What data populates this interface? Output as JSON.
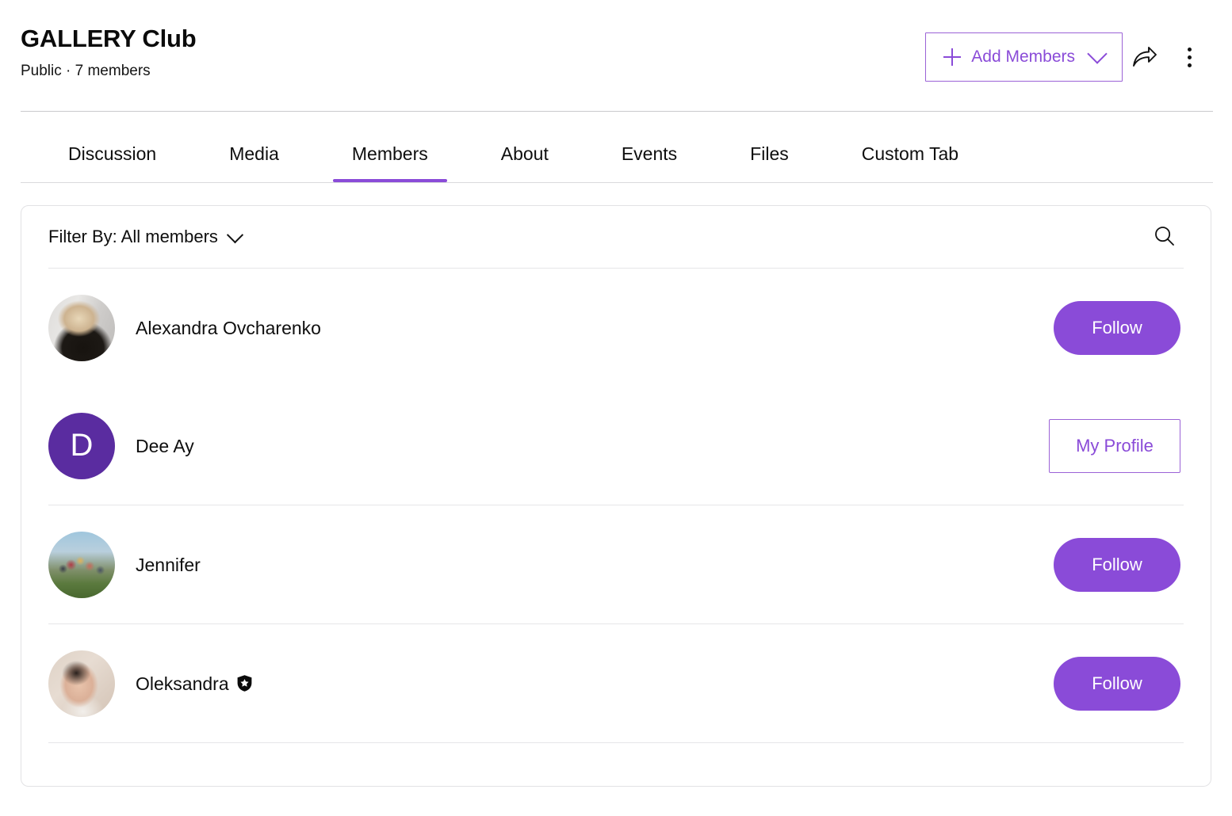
{
  "header": {
    "title": "GALLERY Club",
    "meta": "Public · 7 members",
    "add_members_label": "Add Members",
    "icons": {
      "plus": "plus-icon",
      "chevron": "chevron-down-icon",
      "share": "share-icon",
      "more": "more-vertical-icon"
    }
  },
  "tabs": [
    {
      "label": "Discussion",
      "active": false
    },
    {
      "label": "Media",
      "active": false
    },
    {
      "label": "Members",
      "active": true
    },
    {
      "label": "About",
      "active": false
    },
    {
      "label": "Events",
      "active": false
    },
    {
      "label": "Files",
      "active": false
    },
    {
      "label": "Custom Tab",
      "active": false
    }
  ],
  "filter": {
    "label": "Filter By: All members",
    "chevron_icon": "chevron-down-icon",
    "search_icon": "search-icon"
  },
  "members": [
    {
      "name": "Alexandra Ovcharenko",
      "avatar_type": "photo",
      "avatar_class": "av-alexandra",
      "initial": "",
      "badge": false,
      "action_label": "Follow",
      "action_type": "follow"
    },
    {
      "name": "Dee Ay",
      "avatar_type": "initial",
      "avatar_class": "avatar-initial",
      "initial": "D",
      "badge": false,
      "action_label": "My Profile",
      "action_type": "profile"
    },
    {
      "name": "Jennifer",
      "avatar_type": "photo",
      "avatar_class": "av-jennifer",
      "initial": "",
      "badge": false,
      "action_label": "Follow",
      "action_type": "follow"
    },
    {
      "name": "Oleksandra",
      "avatar_type": "photo",
      "avatar_class": "av-oleksandra",
      "initial": "",
      "badge": true,
      "badge_icon": "shield-star-badge-icon",
      "action_label": "Follow",
      "action_type": "follow"
    }
  ],
  "colors": {
    "accent_purple": "#8a4bd8",
    "avatar_purple": "#5a2ca0",
    "border_gray": "#e2e2e4",
    "divider_gray": "#e6e6e8",
    "text_black": "#0e0e0e"
  }
}
